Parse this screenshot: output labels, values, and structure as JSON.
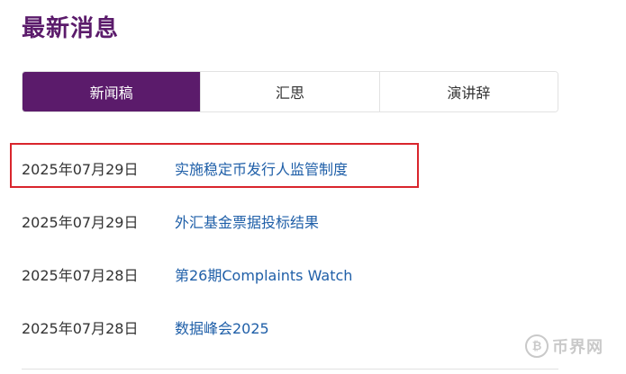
{
  "header": {
    "title": "最新消息"
  },
  "tabs": [
    {
      "label": "新闻稿",
      "active": true
    },
    {
      "label": "汇思",
      "active": false
    },
    {
      "label": "演讲辞",
      "active": false
    }
  ],
  "news": [
    {
      "date": "2025年07月29日",
      "title": "实施稳定币发行人监管制度",
      "highlighted": true
    },
    {
      "date": "2025年07月29日",
      "title": "外汇基金票据投标结果",
      "highlighted": false
    },
    {
      "date": "2025年07月28日",
      "title": "第26期Complaints Watch",
      "highlighted": false
    },
    {
      "date": "2025年07月28日",
      "title": "数据峰会2025",
      "highlighted": false
    }
  ],
  "watermark": {
    "logo_glyph": "₿",
    "text": "币界网"
  },
  "colors": {
    "brand_purple": "#5b1b6b",
    "link_blue": "#1f5fa8",
    "highlight_red": "#d9252c"
  }
}
